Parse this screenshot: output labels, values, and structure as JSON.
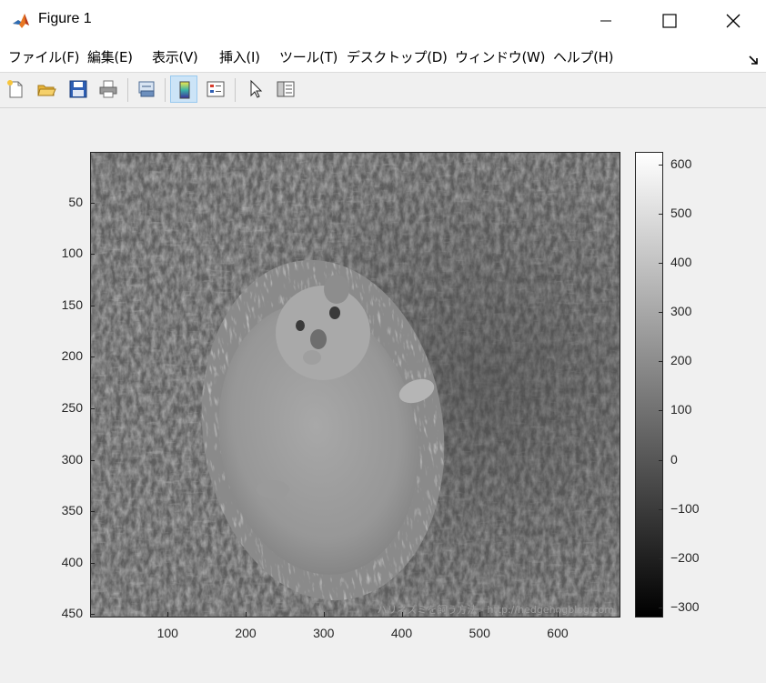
{
  "window": {
    "title": "Figure 1",
    "controls": [
      "minimize",
      "maximize",
      "close"
    ]
  },
  "menu": [
    {
      "label": "ファイル(F)",
      "key": "file"
    },
    {
      "label": "編集(E)",
      "key": "edit"
    },
    {
      "label": "表示(V)",
      "key": "view"
    },
    {
      "label": "挿入(I)",
      "key": "insert"
    },
    {
      "label": "ツール(T)",
      "key": "tools"
    },
    {
      "label": "デスクトップ(D)",
      "key": "desktop"
    },
    {
      "label": "ウィンドウ(W)",
      "key": "window"
    },
    {
      "label": "ヘルプ(H)",
      "key": "help"
    }
  ],
  "toolbar": [
    {
      "icon": "new-figure-icon"
    },
    {
      "icon": "open-file-icon"
    },
    {
      "icon": "save-icon"
    },
    {
      "icon": "print-icon"
    },
    {
      "icon": "link-plot-icon"
    },
    {
      "icon": "insert-colorbar-icon",
      "active": true
    },
    {
      "icon": "insert-legend-icon"
    },
    {
      "icon": "edit-plot-icon"
    },
    {
      "icon": "property-inspector-icon"
    }
  ],
  "image_plot": {
    "description_visible": "grayscale image of a hedgehog lying on grass",
    "watermark": "ハリネズミを飼う方法 - http://hedgehogblog.com",
    "x_ticks": [
      "100",
      "200",
      "300",
      "400",
      "500",
      "600"
    ],
    "y_ticks": [
      "50",
      "100",
      "150",
      "200",
      "250",
      "300",
      "350",
      "400",
      "450"
    ],
    "x_range": [
      0.5,
      680.5
    ],
    "y_range": [
      0.5,
      453.5
    ]
  },
  "colorbar": {
    "ticks": [
      "600",
      "500",
      "400",
      "300",
      "200",
      "100",
      "0",
      "−100",
      "−200",
      "−300"
    ],
    "range": [
      -320,
      625
    ],
    "colormap": "gray"
  },
  "colors": {
    "axis": "#262626",
    "background": "#f0f0f0",
    "toolbar_active": "#cce4f7"
  }
}
